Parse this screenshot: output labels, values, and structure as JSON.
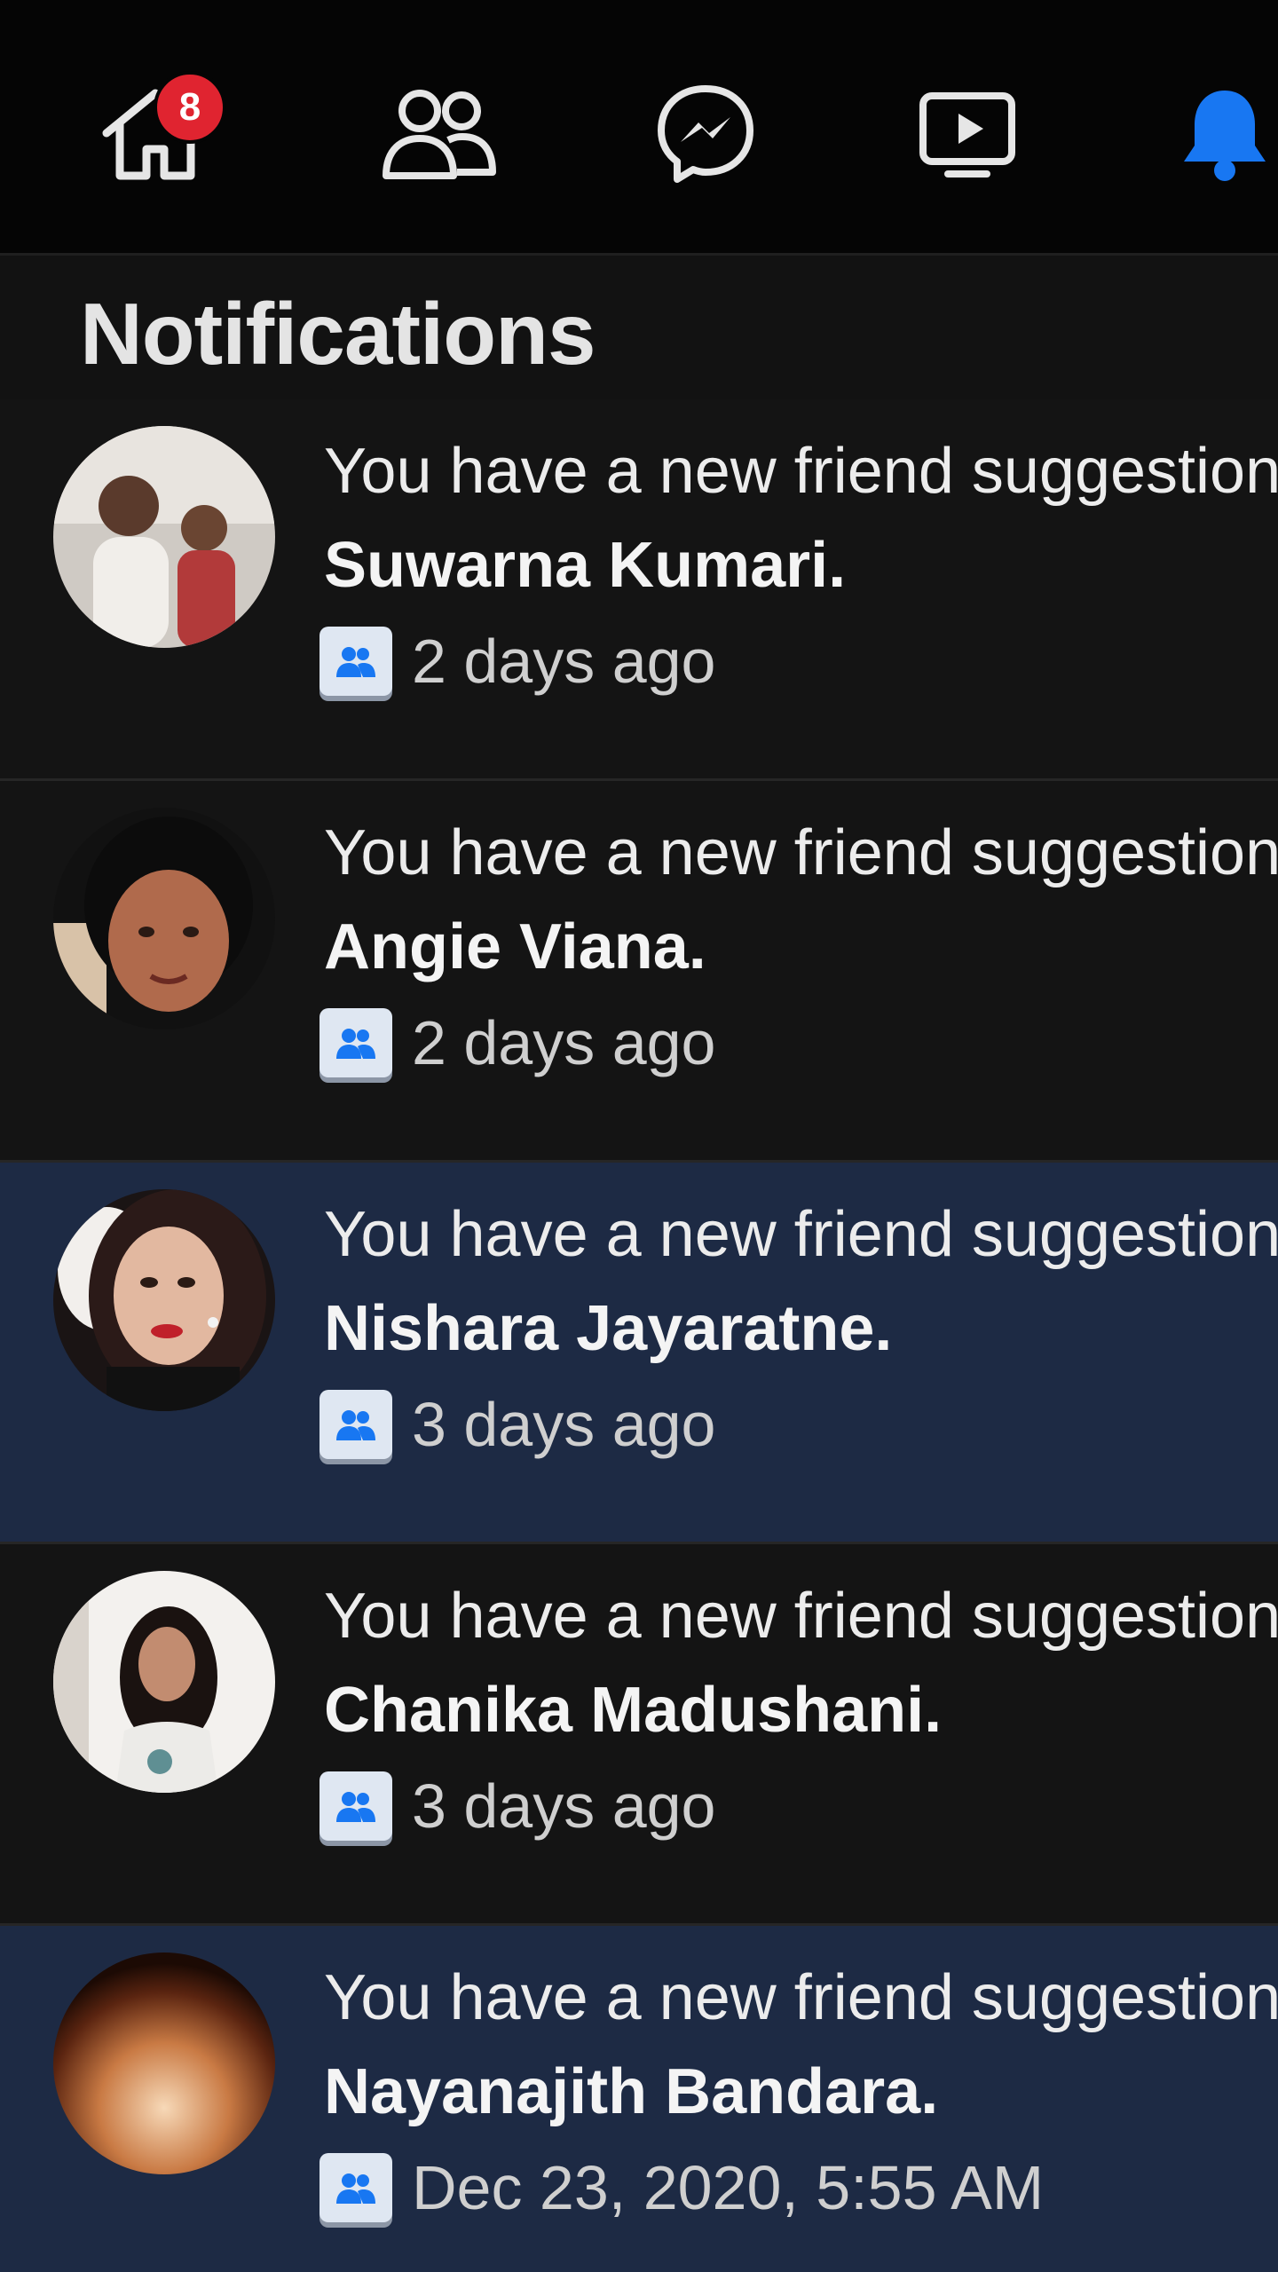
{
  "nav": {
    "tabs": [
      {
        "name": "home-icon",
        "badge": "8"
      },
      {
        "name": "friends-icon"
      },
      {
        "name": "messenger-icon"
      },
      {
        "name": "watch-icon"
      },
      {
        "name": "notifications-bell-icon",
        "active": true
      }
    ],
    "home_badge": "8",
    "active_color": "#1877f2"
  },
  "page_title": "Notifications",
  "notifications": [
    {
      "text": "You have a new friend suggestion:",
      "name": "Suwarna Kumari.",
      "time": "2 days ago",
      "icon": "friend-suggestion-icon",
      "unread": false
    },
    {
      "text": "You have a new friend suggestion:",
      "name": "Angie Viana.",
      "time": "2 days ago",
      "icon": "friend-suggestion-icon",
      "unread": false
    },
    {
      "text": "You have a new friend suggestion:",
      "name": "Nishara Jayaratne.",
      "time": "3 days ago",
      "icon": "friend-suggestion-icon",
      "unread": true
    },
    {
      "text": "You have a new friend suggestion:",
      "name": "Chanika Madushani.",
      "time": "3 days ago",
      "icon": "friend-suggestion-icon",
      "unread": false
    },
    {
      "text": "You have a new friend suggestion:",
      "name": "Nayanajith Bandara.",
      "time": "Dec 23, 2020, 5:55 AM",
      "icon": "friend-suggestion-icon",
      "unread": true
    }
  ],
  "colors": {
    "unread_bg": "#1d2a44",
    "badge": "#e02430"
  }
}
